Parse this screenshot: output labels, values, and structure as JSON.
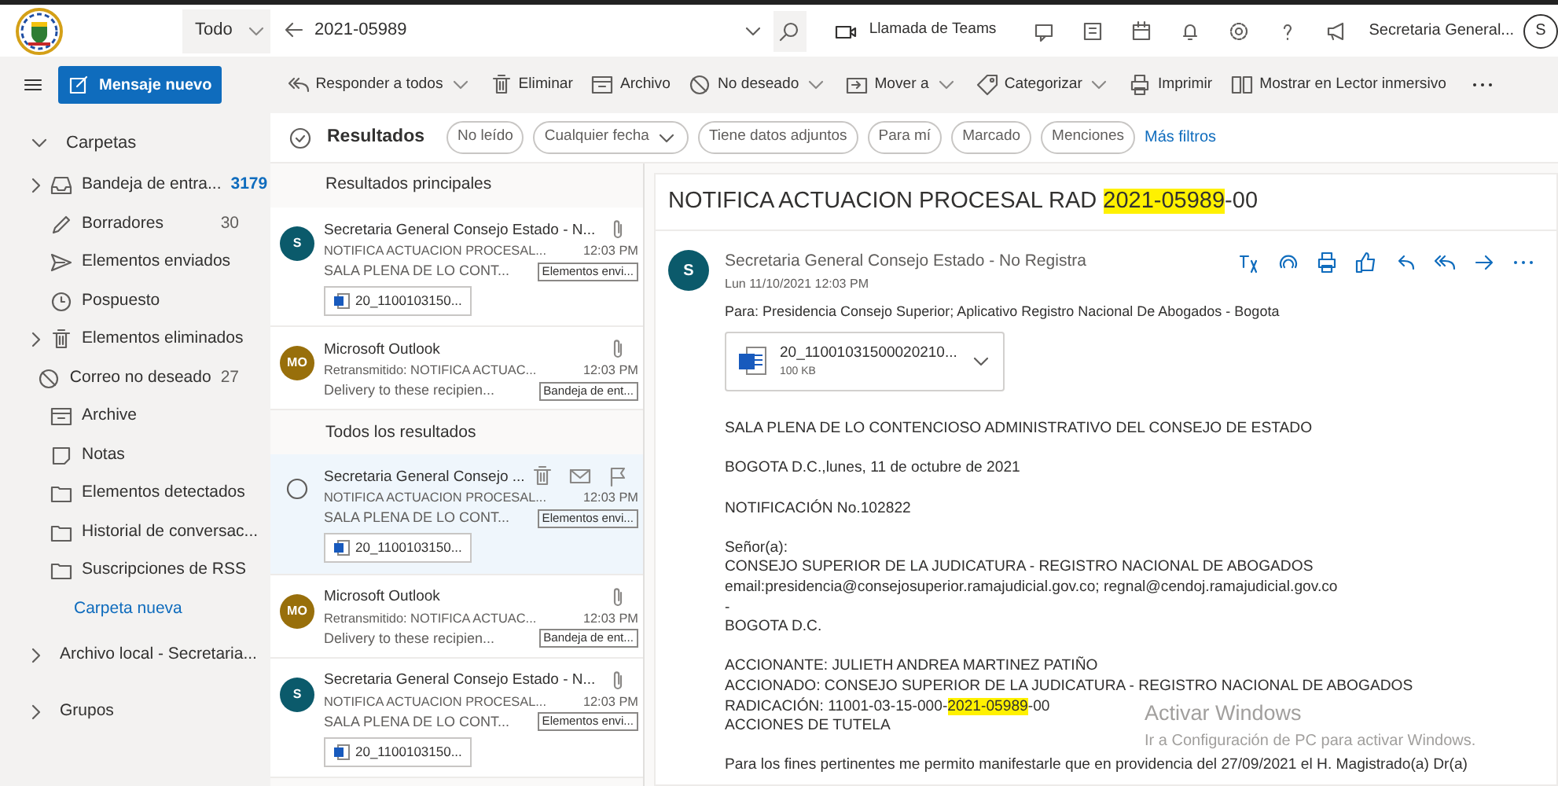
{
  "top_bar": {
    "scope": "Todo",
    "search_value": "2021-05989",
    "teams": "Llamada de Teams",
    "user_name": "Secretaria General...",
    "user_initial": "S"
  },
  "toolbar": {
    "new_message": "Mensaje nuevo",
    "actions": [
      {
        "kind": "reply-all",
        "label": "Responder a todos",
        "dropdown": true
      },
      {
        "kind": "delete",
        "label": "Eliminar",
        "dropdown": false
      },
      {
        "kind": "archive",
        "label": "Archivo",
        "dropdown": false
      },
      {
        "kind": "junk",
        "label": "No deseado",
        "dropdown": true
      },
      {
        "kind": "move",
        "label": "Mover a",
        "dropdown": true
      },
      {
        "kind": "tag",
        "label": "Categorizar",
        "dropdown": true
      },
      {
        "kind": "print",
        "label": "Imprimir",
        "dropdown": false
      },
      {
        "kind": "reader",
        "label": "Mostrar en Lector inmersivo",
        "dropdown": false
      }
    ]
  },
  "sidebar": {
    "header": "Carpetas",
    "expanded": true,
    "items": [
      {
        "label": "Bandeja de entra...",
        "count": "3179",
        "unread": true,
        "has_children": true
      },
      {
        "label": "Borradores",
        "count": "30",
        "unread": false,
        "has_children": false
      },
      {
        "label": "Elementos enviados",
        "has_children": false
      },
      {
        "label": "Pospuesto",
        "has_children": false
      },
      {
        "label": "Elementos eliminados",
        "has_children": true
      },
      {
        "label": "Correo no deseado",
        "count": "27",
        "unread": false,
        "has_children": false
      },
      {
        "label": "Archive",
        "has_children": false
      },
      {
        "label": "Notas",
        "has_children": false
      },
      {
        "label": "Elementos detectados",
        "has_children": false
      },
      {
        "label": "Historial de conversac...",
        "has_children": false
      },
      {
        "label": "Suscripciones de RSS",
        "has_children": false
      }
    ],
    "new_folder": "Carpeta nueva",
    "groups": [
      {
        "label": "Archivo local - Secretaria...",
        "expanded": false
      },
      {
        "label": "Grupos",
        "expanded": false
      }
    ]
  },
  "results": {
    "title": "Resultados",
    "filters": [
      {
        "label": "No leído",
        "dropdown": false
      },
      {
        "label": "Cualquier fecha",
        "dropdown": true
      },
      {
        "label": "Tiene datos adjuntos",
        "dropdown": false
      },
      {
        "label": "Para mí",
        "dropdown": false
      },
      {
        "label": "Marcado",
        "dropdown": false
      },
      {
        "label": "Menciones",
        "dropdown": false
      }
    ],
    "more_filters": "Más filtros",
    "sections": [
      {
        "title": "Resultados principales",
        "messages": [
          {
            "initials": "S",
            "color": "#0b5a6b",
            "sender": "Secretaria General Consejo Estado - N...",
            "subject": "NOTIFICA ACTUACION PROCESAL...",
            "time": "12:03 PM",
            "preview": "SALA PLENA DE LO CONT...",
            "folder": "Elementos envi...",
            "attachment": "20_1100103150...",
            "selected": false
          },
          {
            "initials": "MO",
            "color": "#986f0b",
            "sender": "Microsoft Outlook",
            "subject": "Retransmitido: NOTIFICA ACTUAC...",
            "time": "12:03 PM",
            "preview": "Delivery to these recipien...",
            "folder": "Bandeja de ent...",
            "selected": false
          }
        ]
      },
      {
        "title": "Todos los resultados",
        "messages": [
          {
            "sender": "Secretaria General Consejo ...",
            "subject": "NOTIFICA ACTUACION PROCESAL...",
            "time": "12:03 PM",
            "preview": "SALA PLENA DE LO CONT...",
            "folder": "Elementos envi...",
            "attachment": "20_1100103150...",
            "selected": true
          },
          {
            "initials": "MO",
            "color": "#986f0b",
            "sender": "Microsoft Outlook",
            "subject": "Retransmitido: NOTIFICA ACTUAC...",
            "time": "12:03 PM",
            "preview": "Delivery to these recipien...",
            "folder": "Bandeja de ent...",
            "selected": false
          },
          {
            "initials": "S",
            "color": "#0b5a6b",
            "sender": "Secretaria General Consejo Estado - N...",
            "subject": "NOTIFICA ACTUACION PROCESAL...",
            "time": "12:03 PM",
            "preview": "SALA PLENA DE LO CONT...",
            "folder": "Elementos envi...",
            "attachment": "20_1100103150...",
            "selected": false
          }
        ]
      }
    ]
  },
  "reading": {
    "subject": [
      {
        "text": "NOTIFICA ACTUACION PROCESAL RAD ",
        "highlight": false
      },
      {
        "text": "2021-05989",
        "highlight": true
      },
      {
        "text": "-00",
        "highlight": false
      }
    ],
    "initial": "S",
    "color": "#0b5a6b",
    "sender": "Secretaria General Consejo Estado - No Registra",
    "date": "Lun 11/10/2021 12:03 PM",
    "to": "Para:  Presidencia Consejo Superior; Aplicativo Registro Nacional De Abogados - Bogota",
    "attachment": {
      "name": "20_11001031500020210...",
      "size": "100 KB"
    },
    "body": [
      [
        [
          {
            "text": "SALA PLENA DE LO CONTENCIOSO ADMINISTRATIVO DEL CONSEJO DE ESTADO",
            "highlight": false
          }
        ]
      ],
      [
        [
          {
            "text": "BOGOTA D.C.,lunes, 11 de octubre de 2021",
            "highlight": false
          }
        ]
      ],
      [
        [
          {
            "text": "NOTIFICACIÓN No.102822",
            "highlight": false
          }
        ]
      ],
      [
        [
          {
            "text": "Señor(a):",
            "highlight": false
          }
        ],
        [
          {
            "text": "CONSEJO SUPERIOR DE LA JUDICATURA - REGISTRO NACIONAL DE ABOGADOS",
            "highlight": false
          }
        ],
        [
          {
            "text": "email:presidencia@consejosuperior.ramajudicial.gov.co; regnal@cendoj.ramajudicial.gov.co",
            "highlight": false
          }
        ],
        [
          {
            "text": "-",
            "highlight": false
          }
        ],
        [
          {
            "text": "BOGOTA D.C.",
            "highlight": false
          }
        ]
      ],
      [
        [
          {
            "text": "ACCIONANTE: JULIETH ANDREA MARTINEZ PATIÑO",
            "highlight": false
          }
        ],
        [
          {
            "text": "ACCIONADO: CONSEJO SUPERIOR DE LA JUDICATURA - REGISTRO NACIONAL DE ABOGADOS",
            "highlight": false
          }
        ],
        [
          {
            "text": "RADICACIÓN: 11001-03-15-000-",
            "highlight": false
          },
          {
            "text": "2021-05989",
            "highlight": true
          },
          {
            "text": "-00",
            "highlight": false
          }
        ],
        [
          {
            "text": "ACCIONES DE TUTELA",
            "highlight": false
          }
        ]
      ],
      [
        [
          {
            "text": "Para los fines pertinentes me permito manifestarle que en providencia del 27/09/2021  el H. Magistrado(a) Dr(a)",
            "highlight": false
          }
        ]
      ]
    ]
  },
  "activation": {
    "title": "Activar Windows",
    "text": "Ir a Configuración de PC para activar Windows."
  }
}
